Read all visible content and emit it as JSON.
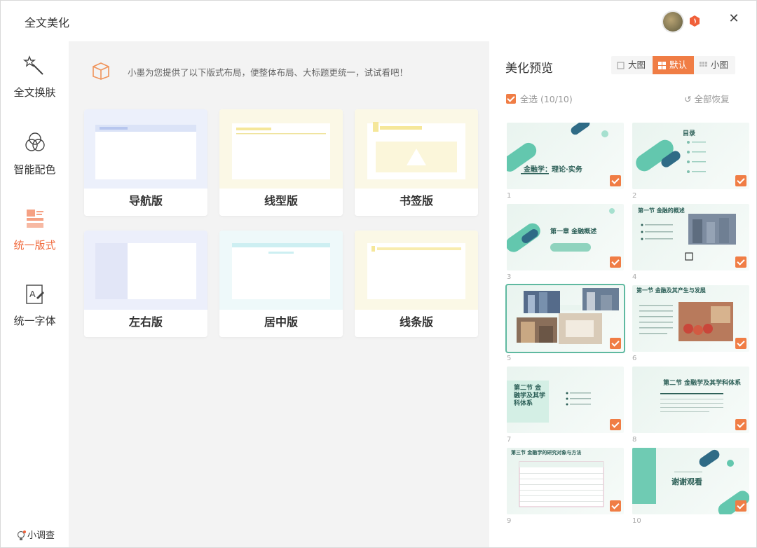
{
  "app": {
    "title": "全文美化"
  },
  "sidebar": {
    "items": [
      {
        "label": "全文换肤",
        "icon": "magic-wand-icon"
      },
      {
        "label": "智能配色",
        "icon": "color-circles-icon"
      },
      {
        "label": "统一版式",
        "icon": "layout-icon",
        "active": true
      },
      {
        "label": "统一字体",
        "icon": "font-icon"
      }
    ],
    "survey": "小调查"
  },
  "center": {
    "tip": "小墨为您提供了以下版式布局，便整体布局、大标题更统一，试试看吧！",
    "layouts": [
      {
        "name": "导航版"
      },
      {
        "name": "线型版"
      },
      {
        "name": "书签版"
      },
      {
        "name": "左右版"
      },
      {
        "name": "居中版"
      },
      {
        "name": "线条版"
      }
    ]
  },
  "preview": {
    "title": "美化预览",
    "view_options": [
      {
        "label": "大图",
        "selected": false
      },
      {
        "label": "默认",
        "selected": true
      },
      {
        "label": "小图",
        "selected": false
      }
    ],
    "select_all": "全选 (10/10)",
    "restore_all": "全部恢复",
    "slides": [
      {
        "num": "1",
        "text": "金融学：理论·实务"
      },
      {
        "num": "2",
        "text": "目录"
      },
      {
        "num": "3",
        "text": "第一章 金融概述"
      },
      {
        "num": "4",
        "text": "第一节 金融的概述"
      },
      {
        "num": "5",
        "text": ""
      },
      {
        "num": "6",
        "text": "第一节 金融及其产生与发展"
      },
      {
        "num": "7",
        "text": "第二节 金融学及其学科体系"
      },
      {
        "num": "8",
        "text": "第二节 金融学及其学科体系"
      },
      {
        "num": "9",
        "text": "第三节 金融学的研究对象与方法"
      },
      {
        "num": "10",
        "text": "谢谢观看"
      }
    ]
  },
  "colors": {
    "accent": "#f07d45",
    "active_text": "#f06a3d",
    "slide_teal": "#5fb9a0"
  }
}
